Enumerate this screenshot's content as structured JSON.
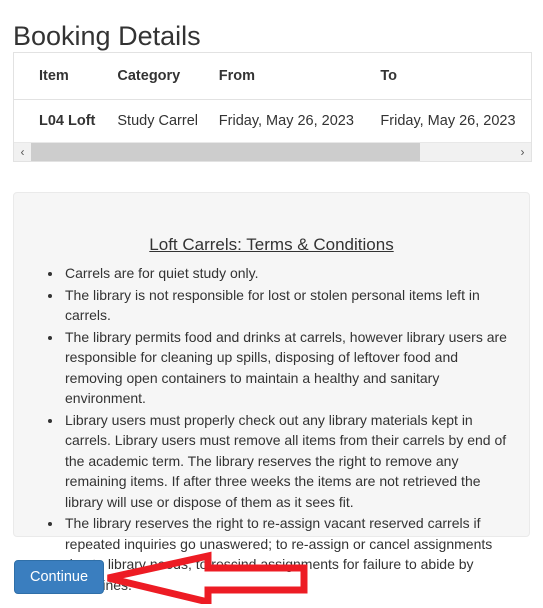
{
  "page": {
    "title": "Booking Details"
  },
  "booking_table": {
    "headers": [
      "Item",
      "Category",
      "From",
      "To"
    ],
    "rows": [
      {
        "item": "L04 Loft",
        "category": "Study Carrel",
        "from": "Friday, May 26, 2023",
        "to": "Friday, May 26, 2023"
      }
    ],
    "scrollbar": {
      "left_arrow": "‹",
      "right_arrow": "›",
      "thumb_percent": 80
    }
  },
  "terms": {
    "title": "Loft Carrels: Terms & Conditions",
    "items": [
      "Carrels are for quiet study only.",
      "The library is not responsible for lost or stolen personal items left in carrels.",
      "The library permits food and drinks at carrels, however library users are responsible for cleaning up spills, disposing of leftover food and removing open containers to maintain a healthy and sanitary environment.",
      "Library users must properly check out any library materials kept in carrels. Library users must remove all items from their carrels by end of the academic term. The library reserves the right to remove any remaining items. If after three weeks the items are not retrieved the library will use or dispose of them as it sees fit.",
      "The library reserves the right to re-assign vacant reserved carrels if repeated inquiries go unaswered; to re-assign or cancel assignments due to library needs; to rescind assignments for failure to abide by guidelines."
    ]
  },
  "actions": {
    "continue_label": "Continue"
  },
  "annotation": {
    "arrow_direction": "left",
    "arrow_color": "#ed1c24",
    "arrow_points_to": "continue-button"
  },
  "colors": {
    "button_blue": "#3a7ebf",
    "panel_background": "#f6f6f6",
    "panel_border": "#eaeaea",
    "table_border": "#e2e2e2",
    "text": "#333333",
    "scrollbar_thumb": "#cdcdcd",
    "scrollbar_track": "#f1f1f1",
    "annotation_red": "#ed1c24"
  }
}
